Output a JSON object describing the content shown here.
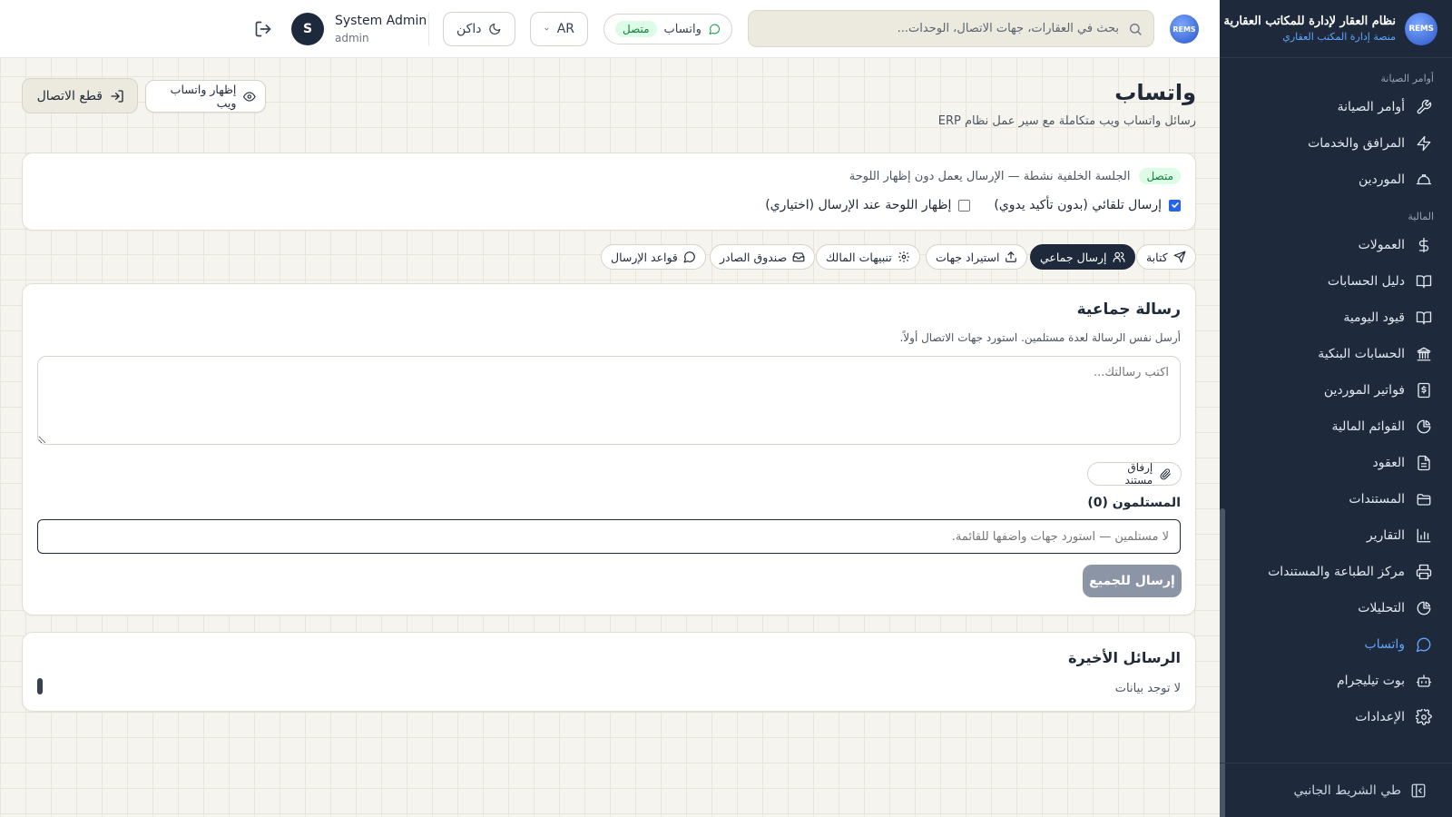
{
  "brand": {
    "title": "نظام العقار لإدارة للمكاتب العقارية",
    "subtitle": "منصة إدارة المكتب العقاري",
    "logo_text": "REMS"
  },
  "sidebar": {
    "sections": [
      {
        "label": "أوامر الصيانة",
        "items": [
          {
            "label": "أوامر الصيانة",
            "icon": "wrench-icon"
          },
          {
            "label": "المرافق والخدمات",
            "icon": "bolt-icon"
          },
          {
            "label": "الموردين",
            "icon": "hardhat-icon"
          }
        ]
      },
      {
        "label": "المالية",
        "items": [
          {
            "label": "العمولات",
            "icon": "dollar-icon"
          },
          {
            "label": "دليل الحسابات",
            "icon": "book-icon"
          },
          {
            "label": "قيود اليومية",
            "icon": "book-icon"
          },
          {
            "label": "الحسابات البنكية",
            "icon": "bank-icon"
          },
          {
            "label": "فواتير الموردين",
            "icon": "receipt-icon"
          },
          {
            "label": "القوائم المالية",
            "icon": "pie-icon"
          },
          {
            "label": "العقود",
            "icon": "document-icon"
          },
          {
            "label": "المستندات",
            "icon": "folder-icon"
          },
          {
            "label": "التقارير",
            "icon": "bar-chart-icon"
          },
          {
            "label": "مركز الطباعة والمستندات",
            "icon": "printer-icon"
          },
          {
            "label": "التحليلات",
            "icon": "pie-icon"
          },
          {
            "label": "واتساب",
            "icon": "chat-icon",
            "active": true
          },
          {
            "label": "بوت تيليجرام",
            "icon": "bot-icon"
          },
          {
            "label": "الإعدادات",
            "icon": "gear-icon"
          }
        ]
      }
    ],
    "collapse_label": "طي الشريط الجانبي"
  },
  "topbar": {
    "search_placeholder": "بحث في العقارات، جهات الاتصال، الوحدات...",
    "whatsapp_label": "واتساب",
    "whatsapp_status": "متصل",
    "language": "AR",
    "theme_label": "داكن",
    "user_initial": "S",
    "user_name": "System Admin",
    "user_role": "admin"
  },
  "page": {
    "title": "واتساب",
    "subtitle": "رسائل واتساب ويب متكاملة مع سير عمل نظام ERP",
    "show_web_button": "إظهار واتساب ويب",
    "disconnect_button": "قطع الاتصال"
  },
  "session": {
    "status_badge": "متصل",
    "status_text": "الجلسة الخلفية نشطة — الإرسال يعمل دون إظهار اللوحة",
    "auto_send_label": "إرسال تلقائي (بدون تأكيد يدوي)",
    "auto_send_checked": true,
    "show_panel_label": "إظهار اللوحة عند الإرسال (اختياري)",
    "show_panel_checked": false
  },
  "tabs": [
    {
      "label": "كتابة",
      "icon": "send-icon"
    },
    {
      "label": "إرسال جماعي",
      "icon": "users-icon",
      "active": true
    },
    {
      "label": "استيراد جهات",
      "icon": "upload-icon"
    },
    {
      "label": "تنبيهات المالك",
      "icon": "gear-icon"
    },
    {
      "label": "صندوق الصادر",
      "icon": "inbox-icon"
    },
    {
      "label": "قواعد الإرسال",
      "icon": "chat-icon"
    }
  ],
  "bulk": {
    "title": "رسالة جماعية",
    "description": "أرسل نفس الرسالة لعدة مستلمين. استورد جهات الاتصال أولاً.",
    "message_placeholder": "اكتب رسالتك...",
    "attach_button": "إرفاق مستند",
    "recipients_label": "المستلمون (0)",
    "recipients_placeholder": "لا مستلمين — استورد جهات وأضفها للقائمة.",
    "send_all_button": "إرسال للجميع"
  },
  "recent": {
    "title": "الرسائل الأخيرة",
    "empty": "لا توجد بيانات"
  },
  "colors": {
    "sidebar_bg": "#1e293b",
    "accent": "#60a5fa",
    "success": "#15803d",
    "disabled_button": "#8b95a5"
  }
}
